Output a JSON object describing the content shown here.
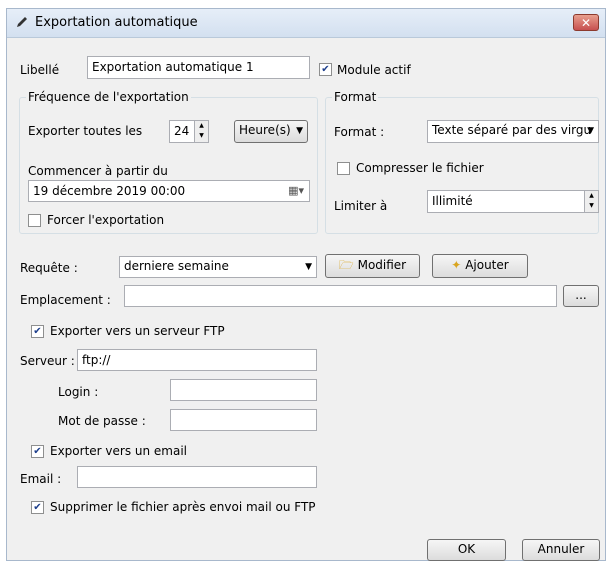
{
  "window": {
    "title": "Exportation automatique"
  },
  "libelle": {
    "label": "Libellé",
    "value": "Exportation automatique 1"
  },
  "module_actif": {
    "label": "Module actif",
    "checked": true
  },
  "frequence": {
    "group_title": "Fréquence de l'exportation",
    "every_label": "Exporter toutes les",
    "every_value": "24",
    "unit": "Heure(s)",
    "start_label": "Commencer à partir du",
    "start_value": "19 décembre 2019 00:00",
    "force_label": "Forcer l'exportation",
    "force_checked": false
  },
  "format": {
    "group_title": "Format",
    "format_label": "Format :",
    "format_value": "Texte séparé par des virgu",
    "compress_label": "Compresser le fichier",
    "compress_checked": false,
    "limit_label": "Limiter à",
    "limit_value": "Illimité"
  },
  "requete": {
    "label": "Requête :",
    "value": "derniere semaine",
    "modify": "Modifier",
    "add": "Ajouter"
  },
  "emplacement": {
    "label": "Emplacement :",
    "value": "",
    "browse": "..."
  },
  "ftp": {
    "export_label": "Exporter vers un serveur FTP",
    "export_checked": true,
    "server_label": "Serveur :",
    "server_value": "ftp://",
    "login_label": "Login :",
    "login_value": "",
    "password_label": "Mot de passe :",
    "password_value": ""
  },
  "email": {
    "export_label": "Exporter vers un email",
    "export_checked": true,
    "label": "Email :",
    "value": ""
  },
  "delete_after": {
    "label": "Supprimer le fichier après envoi mail ou FTP",
    "checked": true
  },
  "buttons": {
    "ok": "OK",
    "cancel": "Annuler"
  }
}
